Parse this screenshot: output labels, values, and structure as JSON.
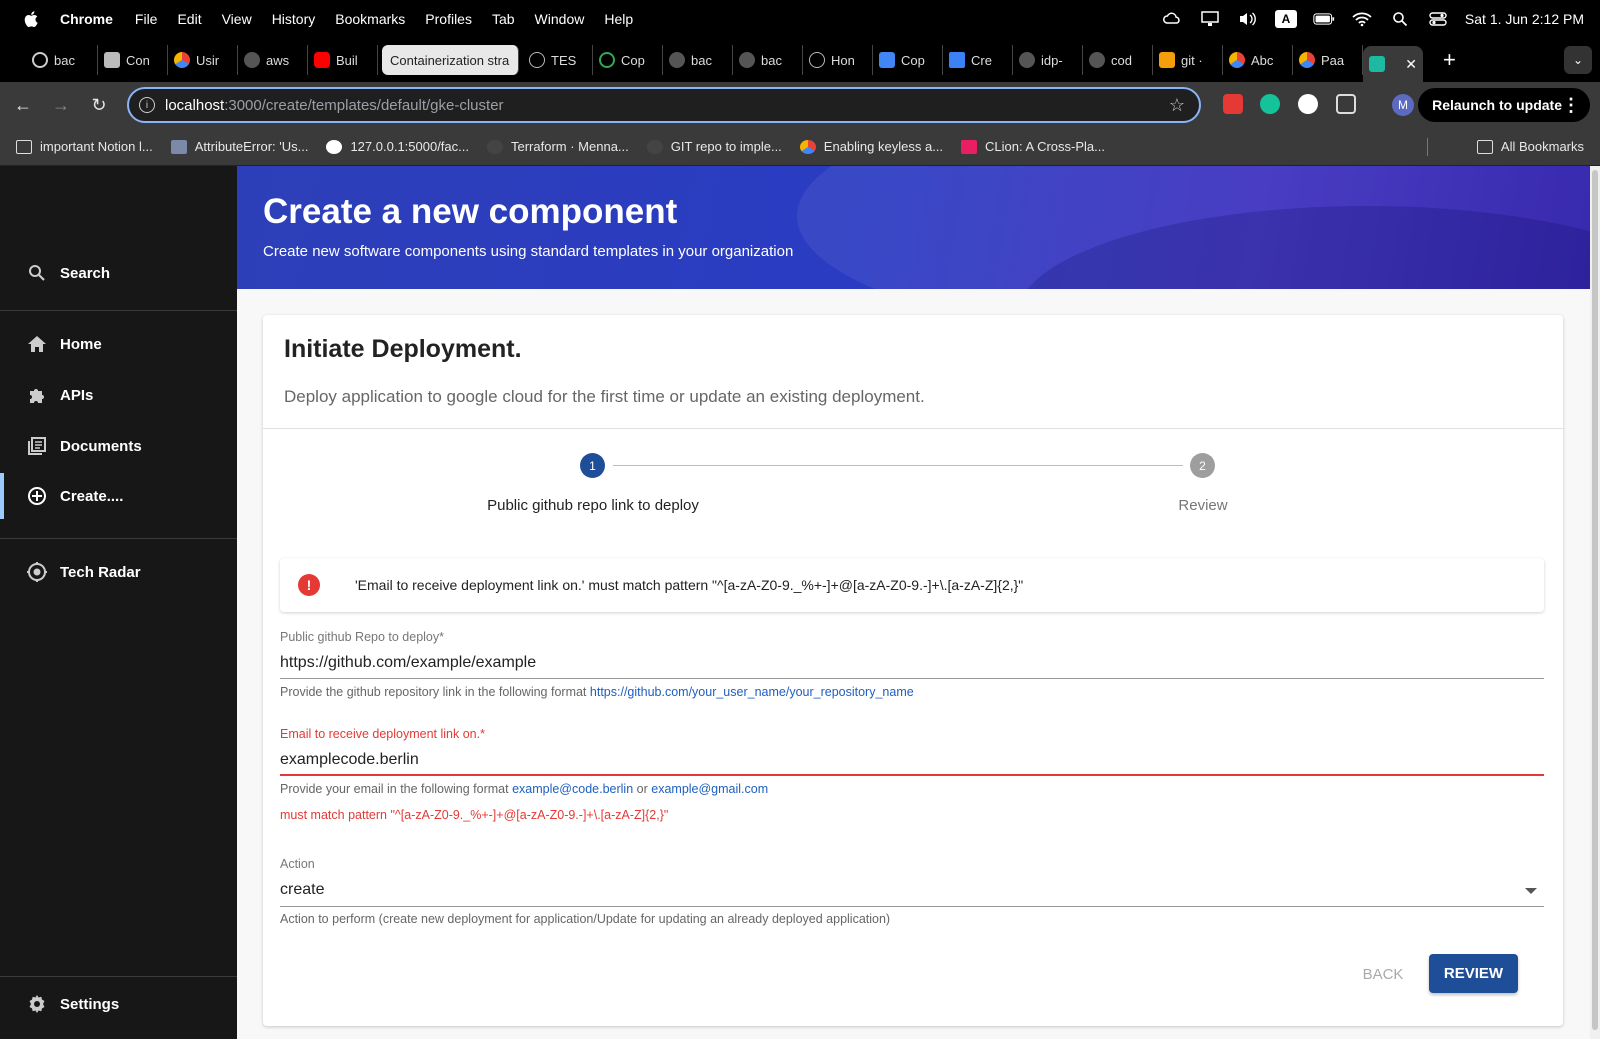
{
  "menubar": {
    "app": "Chrome",
    "items": [
      "File",
      "Edit",
      "View",
      "History",
      "Bookmarks",
      "Profiles",
      "Tab",
      "Window",
      "Help"
    ],
    "keyboard_indicator": "A",
    "clock": "Sat 1. Jun  2:12 PM"
  },
  "tabs": [
    {
      "title": "bac",
      "color": "#cccccc"
    },
    {
      "title": "Con",
      "color": "#bbbbbb"
    },
    {
      "title": "Usir",
      "color": "#f4b400"
    },
    {
      "title": "aws",
      "color": "#888888"
    },
    {
      "title": "Buil",
      "color": "#ff0000"
    },
    {
      "title": "Containerization stra",
      "color": "#e8e8e8"
    },
    {
      "title": "TES",
      "color": "#bbbbbb"
    },
    {
      "title": "Cop",
      "color": "#34a853"
    },
    {
      "title": "bac",
      "color": "#888888"
    },
    {
      "title": "bac",
      "color": "#888888"
    },
    {
      "title": "Hon",
      "color": "#bbbbbb"
    },
    {
      "title": "Cop",
      "color": "#4285f4"
    },
    {
      "title": "Cre",
      "color": "#3b82f6"
    },
    {
      "title": "idp-",
      "color": "#888888"
    },
    {
      "title": "cod",
      "color": "#888888"
    },
    {
      "title": "git ·",
      "color": "#f59e0b"
    },
    {
      "title": "Abc",
      "color": "#f4b400"
    },
    {
      "title": "Paa",
      "color": "#f4b400"
    }
  ],
  "toolbar": {
    "url_host": "localhost",
    "url_path": ":3000/create/templates/default/gke-cluster",
    "profile_initial": "M",
    "relaunch_label": "Relaunch to update"
  },
  "bookmarks": [
    {
      "label": "important Notion l...",
      "color": "#dddddd"
    },
    {
      "label": "AttributeError: 'Us...",
      "color": "#7a8aa8"
    },
    {
      "label": "127.0.0.1:5000/fac...",
      "color": "#ffffff"
    },
    {
      "label": "Terraform · Menna...",
      "color": "#444444"
    },
    {
      "label": "GIT repo to imple...",
      "color": "#444444"
    },
    {
      "label": "Enabling keyless a...",
      "color": "#f4b400"
    },
    {
      "label": "CLion: A Cross-Pla...",
      "color": "#e91e63"
    }
  ],
  "bookmarks_all": "All Bookmarks",
  "sidebar": {
    "search": "Search",
    "home": "Home",
    "apis": "APIs",
    "documents": "Documents",
    "create": "Create....",
    "tech_radar": "Tech Radar",
    "settings": "Settings"
  },
  "header": {
    "title": "Create a new component",
    "subtitle": "Create new software components using standard templates in your organization"
  },
  "card": {
    "title": "Initiate Deployment.",
    "subtitle": "Deploy application to google cloud for the first time or update an existing deployment."
  },
  "stepper": {
    "steps": [
      {
        "number": "1",
        "label": "Public github repo link to deploy",
        "active": true
      },
      {
        "number": "2",
        "label": "Review",
        "active": false
      }
    ]
  },
  "alert": {
    "text": "'Email to receive deployment link on.' must match pattern \"^[a-zA-Z0-9._%+-]+@[a-zA-Z0-9.-]+\\.[a-zA-Z]{2,}\""
  },
  "form": {
    "repo": {
      "label": "Public github Repo to deploy*",
      "value": "https://github.com/example/example",
      "helper_prefix": "Provide the github repository link in the following format",
      "helper_link": "https://github.com/your_user_name/your_repository_name"
    },
    "email": {
      "label": "Email to receive deployment link on.*",
      "value": "examplecode.berlin",
      "helper_prefix": "Provide your email in the following format",
      "helper_link1": "example@code.berlin",
      "helper_or": "or",
      "helper_link2": "example@gmail.com",
      "error": "must match pattern \"^[a-zA-Z0-9._%+-]+@[a-zA-Z0-9.-]+\\.[a-zA-Z]{2,}\""
    },
    "action": {
      "label": "Action",
      "value": "create",
      "helper": "Action to perform (create new deployment for application/Update for updating an already deployed application)"
    }
  },
  "buttons": {
    "back": "BACK",
    "review": "REVIEW"
  },
  "colors": {
    "accent": "#1f4e99",
    "error": "#e53935",
    "active_step": "#1f4e99",
    "inactive_step": "#9e9e9e"
  }
}
